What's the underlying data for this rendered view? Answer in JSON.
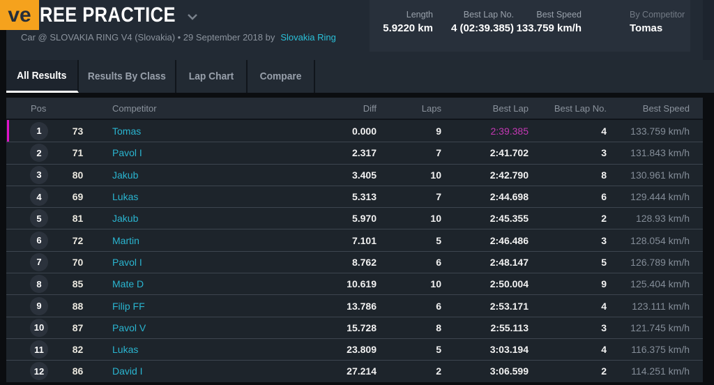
{
  "header": {
    "logo_text": "ve",
    "title": "REE PRACTICE",
    "subtitle": "Car @ SLOVAKIA RING V4 (Slovakia) • 29 September 2018 by",
    "subtitle_link": "Slovakia Ring",
    "stats": [
      {
        "label": "Length",
        "value": "5.9220 km"
      },
      {
        "label": "Best Lap No.",
        "value": "4 (02:39.385)"
      },
      {
        "label": "Best Speed",
        "value": "133.759 km/h"
      },
      {
        "label": "By Competitor",
        "value": "Tomas"
      }
    ]
  },
  "tabs": [
    {
      "label": "All Results",
      "active": true
    },
    {
      "label": "Results By Class",
      "active": false
    },
    {
      "label": "Lap Chart",
      "active": false
    },
    {
      "label": "Compare",
      "active": false
    }
  ],
  "table": {
    "columns": {
      "pos": "Pos",
      "competitor": "Competitor",
      "diff": "Diff",
      "laps": "Laps",
      "best_lap": "Best Lap",
      "best_lap_no": "Best Lap No.",
      "best_speed": "Best Speed"
    },
    "rows": [
      {
        "pos": "1",
        "number": "73",
        "name": "Tomas",
        "diff": "0.000",
        "laps": "9",
        "best_lap": "2:39.385",
        "best_lap_no": "4",
        "best_speed": "133.759 km/h",
        "fastest": true
      },
      {
        "pos": "2",
        "number": "71",
        "name": "Pavol I",
        "diff": "2.317",
        "laps": "7",
        "best_lap": "2:41.702",
        "best_lap_no": "3",
        "best_speed": "131.843 km/h",
        "fastest": false
      },
      {
        "pos": "3",
        "number": "80",
        "name": "Jakub",
        "diff": "3.405",
        "laps": "10",
        "best_lap": "2:42.790",
        "best_lap_no": "8",
        "best_speed": "130.961 km/h",
        "fastest": false
      },
      {
        "pos": "4",
        "number": "69",
        "name": "Lukas",
        "diff": "5.313",
        "laps": "7",
        "best_lap": "2:44.698",
        "best_lap_no": "6",
        "best_speed": "129.444 km/h",
        "fastest": false
      },
      {
        "pos": "5",
        "number": "81",
        "name": "Jakub",
        "diff": "5.970",
        "laps": "10",
        "best_lap": "2:45.355",
        "best_lap_no": "2",
        "best_speed": "128.93 km/h",
        "fastest": false
      },
      {
        "pos": "6",
        "number": "72",
        "name": "Martin",
        "diff": "7.101",
        "laps": "5",
        "best_lap": "2:46.486",
        "best_lap_no": "3",
        "best_speed": "128.054 km/h",
        "fastest": false
      },
      {
        "pos": "7",
        "number": "70",
        "name": "Pavol I",
        "diff": "8.762",
        "laps": "6",
        "best_lap": "2:48.147",
        "best_lap_no": "5",
        "best_speed": "126.789 km/h",
        "fastest": false
      },
      {
        "pos": "8",
        "number": "85",
        "name": "Mate D",
        "diff": "10.619",
        "laps": "10",
        "best_lap": "2:50.004",
        "best_lap_no": "9",
        "best_speed": "125.404 km/h",
        "fastest": false
      },
      {
        "pos": "9",
        "number": "88",
        "name": "Filip FF",
        "diff": "13.786",
        "laps": "6",
        "best_lap": "2:53.171",
        "best_lap_no": "4",
        "best_speed": "123.111 km/h",
        "fastest": false
      },
      {
        "pos": "10",
        "number": "87",
        "name": "Pavol V",
        "diff": "15.728",
        "laps": "8",
        "best_lap": "2:55.113",
        "best_lap_no": "3",
        "best_speed": "121.745 km/h",
        "fastest": false
      },
      {
        "pos": "11",
        "number": "82",
        "name": "Lukas",
        "diff": "23.809",
        "laps": "5",
        "best_lap": "3:03.194",
        "best_lap_no": "4",
        "best_speed": "116.375 km/h",
        "fastest": false
      },
      {
        "pos": "12",
        "number": "86",
        "name": "David I",
        "diff": "27.214",
        "laps": "2",
        "best_lap": "3:06.599",
        "best_lap_no": "2",
        "best_speed": "114.251 km/h",
        "fastest": false
      }
    ]
  },
  "colors": {
    "accent_orange": "#f5a21d",
    "link_cyan": "#2bc0d8",
    "name_cyan": "#2ab5d0",
    "fastest_magenta": "#c438b4",
    "row_indicator": "#e012c8",
    "header_bg": "#222a34",
    "stats_card_bg": "#28303b",
    "tabbar_bg": "#222a33",
    "row_bg": "#1d242b",
    "table_header_bg": "#242b34",
    "page_bg": "#0b0d10"
  }
}
